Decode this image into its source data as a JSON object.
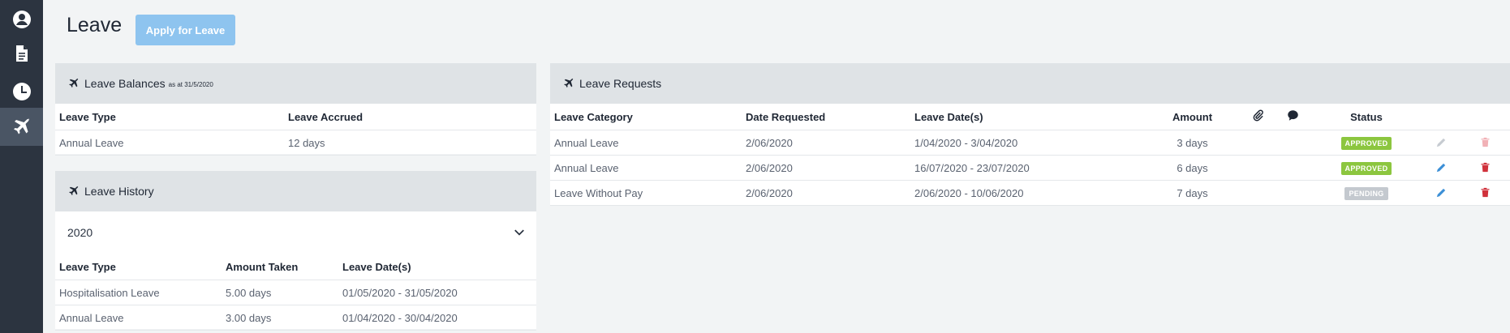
{
  "colors": {
    "sidebar_bg": "#2c3440",
    "sidebar_active": "#4a5564",
    "accent_button": "#8ec4ef",
    "card_header_bg": "#dfe3e6",
    "approved": "#8cc63f",
    "pending": "#c4c9cf",
    "edit": "#3b8fd6",
    "delete": "#d0313b"
  },
  "sidebar": {
    "items": [
      {
        "icon": "user-icon"
      },
      {
        "icon": "document-icon"
      },
      {
        "icon": "clock-icon"
      },
      {
        "icon": "airplane-icon",
        "active": true
      }
    ]
  },
  "header": {
    "title": "Leave",
    "apply_button": "Apply for Leave"
  },
  "balances": {
    "title": "Leave Balances",
    "subtitle": "as at 31/5/2020",
    "columns": [
      "Leave Type",
      "Leave Accrued"
    ],
    "rows": [
      {
        "type": "Annual Leave",
        "accrued": "12 days"
      }
    ]
  },
  "history": {
    "title": "Leave History",
    "year": "2020",
    "columns": [
      "Leave Type",
      "Amount Taken",
      "Leave Date(s)"
    ],
    "rows": [
      {
        "type": "Hospitalisation Leave",
        "amount": "5.00 days",
        "dates": "01/05/2020 - 31/05/2020"
      },
      {
        "type": "Annual Leave",
        "amount": "3.00 days",
        "dates": "01/04/2020 - 30/04/2020"
      }
    ]
  },
  "requests": {
    "title": "Leave Requests",
    "columns": {
      "category": "Leave Category",
      "date_requested": "Date Requested",
      "leave_dates": "Leave Date(s)",
      "amount": "Amount",
      "attachment_icon": "paperclip-icon",
      "comment_icon": "comment-icon",
      "status": "Status"
    },
    "rows": [
      {
        "category": "Annual Leave",
        "date_requested": "2/06/2020",
        "leave_dates": "1/04/2020 - 3/04/2020",
        "amount": "3 days",
        "status": "APPROVED",
        "editable": false
      },
      {
        "category": "Annual Leave",
        "date_requested": "2/06/2020",
        "leave_dates": "16/07/2020 - 23/07/2020",
        "amount": "6 days",
        "status": "APPROVED",
        "editable": true
      },
      {
        "category": "Leave Without Pay",
        "date_requested": "2/06/2020",
        "leave_dates": "2/06/2020 - 10/06/2020",
        "amount": "7 days",
        "status": "PENDING",
        "editable": true
      }
    ]
  }
}
